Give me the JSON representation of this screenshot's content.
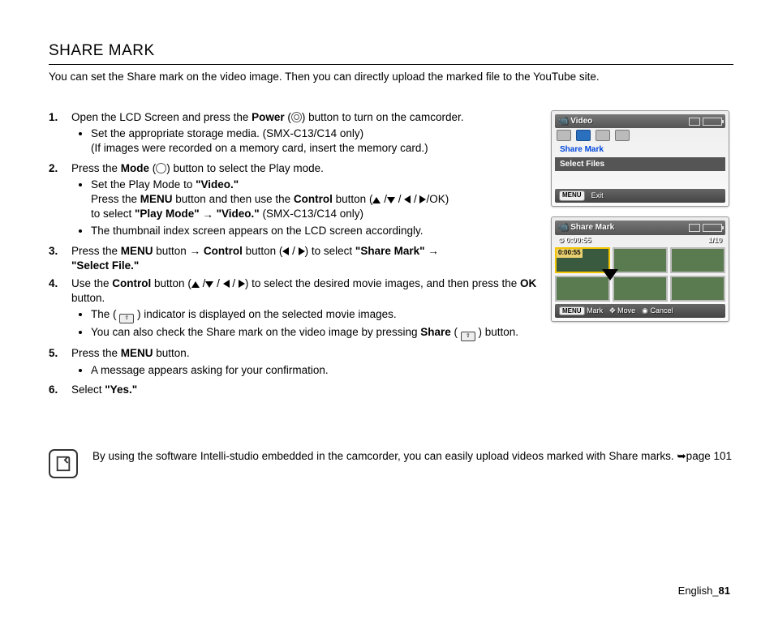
{
  "title": "SHARE MARK",
  "intro": "You can set the Share mark on the video image. Then you can directly upload the marked file to the YouTube site.",
  "steps": {
    "s1": {
      "pre": "Open the LCD Screen and press the ",
      "power": "Power",
      "post": " button to turn on the camcorder.",
      "b1": "Set the appropriate storage media. (SMX-C13/C14 only)",
      "b1sub": "(If images were recorded on a memory card, insert the memory card.)"
    },
    "s2": {
      "pre": "Press the ",
      "mode": "Mode",
      "post": " button to select the Play mode.",
      "b1pre": "Set the Play Mode to ",
      "b1val": "\"Video.\"",
      "b1sub1a": "Press the ",
      "b1sub1b": "MENU",
      "b1sub1c": " button and then use the ",
      "b1sub1d": "Control",
      "b1sub1e": " button (",
      "b1sub2a": "to select ",
      "b1sub2b": "\"Play Mode\"",
      "b1sub2c": "\"Video.\"",
      "b1sub2d": " (SMX-C13/C14 only)",
      "oksuffix": "/OK)",
      "b2": "The thumbnail index screen appears on the LCD screen accordingly."
    },
    "s3": {
      "pre": "Press the ",
      "menu": "MENU",
      "mid1": " button ",
      "ctrl": "Control",
      "mid2": " button (",
      "mid3": ") to select ",
      "sm": "\"Share Mark\"",
      "sf": "\"Select File.\""
    },
    "s4": {
      "pre": "Use the ",
      "ctrl": "Control",
      "mid": " button (",
      "post": ") to select the desired movie images, and then press the ",
      "ok": "OK",
      "post2": " button.",
      "b1a": "The ( ",
      "b1b": " ) indicator is displayed on the selected movie images.",
      "b2a": "You can also check the Share mark on the video image by pressing ",
      "b2b": "Share",
      "b2c": " ( ",
      "b2d": " ) button."
    },
    "s5": {
      "pre": "Press the ",
      "menu": "MENU",
      "post": " button.",
      "b1": "A message appears asking for your confirmation."
    },
    "s6": {
      "pre": "Select ",
      "yes": "\"Yes.\""
    }
  },
  "screen1": {
    "title": "Video",
    "item1": "Share Mark",
    "item2": "Select Files",
    "exit": "Exit"
  },
  "screen2": {
    "title": "Share Mark",
    "dur": "0:00:55",
    "count": "1/10",
    "mark": "Mark",
    "move": "Move",
    "cancel": "Cancel"
  },
  "note": "By using the software Intelli-studio embedded in the camcorder, you can easily upload videos marked with Share marks. ➥page 101",
  "footer": {
    "lang": "English_",
    "page": "81"
  }
}
